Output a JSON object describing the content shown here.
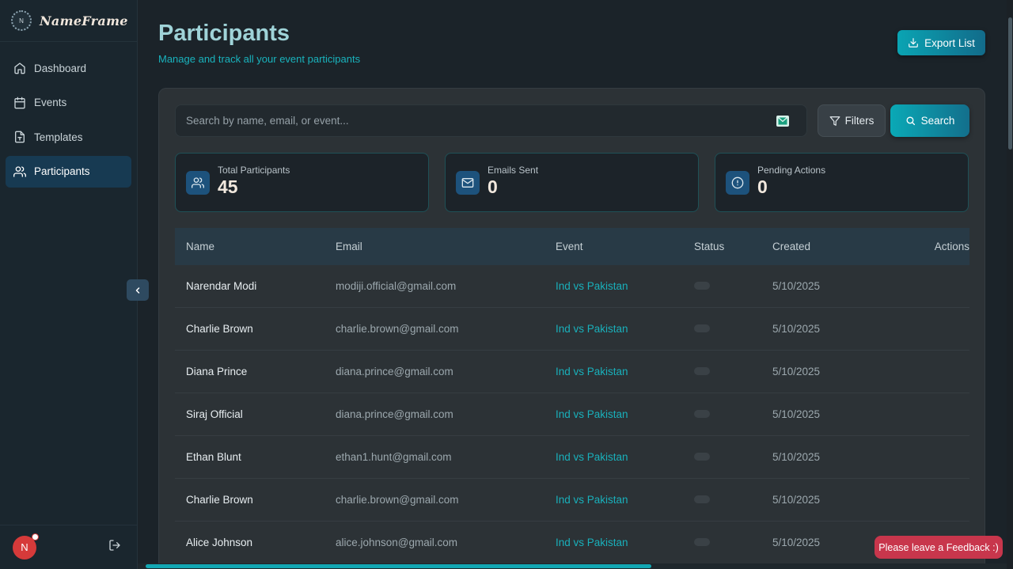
{
  "brand": {
    "name": "NameFrame",
    "logo_letter": "N"
  },
  "sidebar": {
    "items": [
      {
        "label": "Dashboard",
        "icon": "home-icon",
        "active": false
      },
      {
        "label": "Events",
        "icon": "calendar-icon",
        "active": false
      },
      {
        "label": "Templates",
        "icon": "file-text-icon",
        "active": false
      },
      {
        "label": "Participants",
        "icon": "users-icon",
        "active": true
      }
    ],
    "user_initial": "N"
  },
  "header": {
    "title": "Participants",
    "subtitle": "Manage and track all your event participants",
    "export_label": "Export List"
  },
  "search": {
    "placeholder": "Search by name, email, or event...",
    "value": "",
    "filters_label": "Filters",
    "search_label": "Search"
  },
  "stats": [
    {
      "label": "Total Participants",
      "value": "45",
      "icon": "users-icon"
    },
    {
      "label": "Emails Sent",
      "value": "0",
      "icon": "mail-icon"
    },
    {
      "label": "Pending Actions",
      "value": "0",
      "icon": "alert-circle-icon"
    }
  ],
  "table": {
    "columns": [
      "Name",
      "Email",
      "Event",
      "Status",
      "Created",
      "Actions"
    ],
    "rows": [
      {
        "name": "Narendar Modi",
        "email": "modiji.official@gmail.com",
        "event": "Ind vs Pakistan",
        "created": "5/10/2025"
      },
      {
        "name": "Charlie Brown",
        "email": "charlie.brown@gmail.com",
        "event": "Ind vs Pakistan",
        "created": "5/10/2025"
      },
      {
        "name": "Diana Prince",
        "email": "diana.prince@gmail.com",
        "event": "Ind vs Pakistan",
        "created": "5/10/2025"
      },
      {
        "name": "Siraj Official",
        "email": "diana.prince@gmail.com",
        "event": "Ind vs Pakistan",
        "created": "5/10/2025"
      },
      {
        "name": "Ethan Blunt",
        "email": "ethan1.hunt@gmail.com",
        "event": "Ind vs Pakistan",
        "created": "5/10/2025"
      },
      {
        "name": "Charlie Brown",
        "email": "charlie.brown@gmail.com",
        "event": "Ind vs Pakistan",
        "created": "5/10/2025"
      },
      {
        "name": "Alice Johnson",
        "email": "alice.johnson@gmail.com",
        "event": "Ind vs Pakistan",
        "created": "5/10/2025"
      }
    ]
  },
  "feedback_label": "Please leave a Feedback :)",
  "colors": {
    "accent": "#19b3bd",
    "active_nav": "#173a52",
    "feedback": "#c8364c"
  }
}
